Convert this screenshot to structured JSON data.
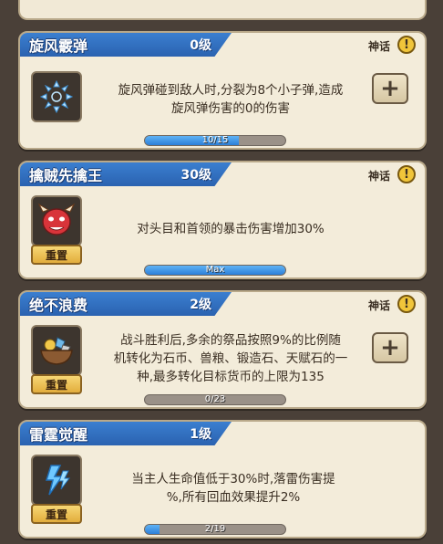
{
  "cards": [
    {
      "name": "旋风霰弹",
      "level": "0级",
      "rarity": "神话",
      "description": "旋风弹碰到敌人时,分裂为8个小子弹,造成\n旋风弹伤害的0的伤害",
      "progress_text": "10/15",
      "progress": 0.667,
      "has_plus": true,
      "has_reset": false,
      "icon": "whirlwind-shrapnel-icon"
    },
    {
      "name": "擒贼先擒王",
      "level": "30级",
      "rarity": "神话",
      "description": "对头目和首领的暴击伤害增加30%",
      "progress_text": "Max",
      "progress": 1.0,
      "has_plus": false,
      "has_reset": true,
      "reset_label": "重置",
      "icon": "demon-head-icon"
    },
    {
      "name": "绝不浪费",
      "level": "2级",
      "rarity": "神话",
      "description": "战斗胜利后,多余的祭品按照9%的比例随\n机转化为石币、兽粮、锻造石、天赋石的一\n种,最多转化目标货币的上限为135",
      "progress_text": "0/23",
      "progress": 0.0,
      "has_plus": true,
      "has_reset": true,
      "reset_label": "重置",
      "icon": "resource-bowl-icon"
    },
    {
      "name": "雷霆觉醒",
      "level": "1级",
      "rarity": "",
      "description": "当主人生命值低于30%时,落雷伤害提\n%,所有回血效果提升2%",
      "progress_text": "2/19",
      "progress": 0.105,
      "has_plus": false,
      "has_reset": true,
      "reset_label": "重置",
      "icon": "lightning-icon"
    }
  ],
  "colors": {
    "ribbon": "#3276c4",
    "card_bg": "#f3ecda",
    "progress_fill": "#2d7fd8",
    "reset_button": "#e9bb4f"
  }
}
